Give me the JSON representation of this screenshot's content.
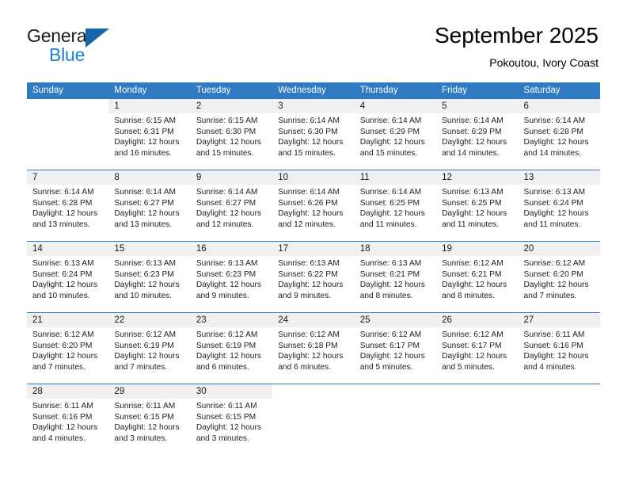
{
  "brand": {
    "name_part1": "General",
    "name_part2": "Blue",
    "accent_color": "#1f7fd0",
    "triangle_color": "#1565a8"
  },
  "header": {
    "title": "September 2025",
    "subtitle": "Pokoutou, Ivory Coast"
  },
  "calendar": {
    "header_bg": "#2f7ac0",
    "daynum_bg": "#f0f0f0",
    "weekdays": [
      "Sunday",
      "Monday",
      "Tuesday",
      "Wednesday",
      "Thursday",
      "Friday",
      "Saturday"
    ],
    "weeks": [
      [
        {
          "day": "",
          "sunrise": "",
          "sunset": "",
          "daylight1": "",
          "daylight2": ""
        },
        {
          "day": "1",
          "sunrise": "Sunrise: 6:15 AM",
          "sunset": "Sunset: 6:31 PM",
          "daylight1": "Daylight: 12 hours",
          "daylight2": "and 16 minutes."
        },
        {
          "day": "2",
          "sunrise": "Sunrise: 6:15 AM",
          "sunset": "Sunset: 6:30 PM",
          "daylight1": "Daylight: 12 hours",
          "daylight2": "and 15 minutes."
        },
        {
          "day": "3",
          "sunrise": "Sunrise: 6:14 AM",
          "sunset": "Sunset: 6:30 PM",
          "daylight1": "Daylight: 12 hours",
          "daylight2": "and 15 minutes."
        },
        {
          "day": "4",
          "sunrise": "Sunrise: 6:14 AM",
          "sunset": "Sunset: 6:29 PM",
          "daylight1": "Daylight: 12 hours",
          "daylight2": "and 15 minutes."
        },
        {
          "day": "5",
          "sunrise": "Sunrise: 6:14 AM",
          "sunset": "Sunset: 6:29 PM",
          "daylight1": "Daylight: 12 hours",
          "daylight2": "and 14 minutes."
        },
        {
          "day": "6",
          "sunrise": "Sunrise: 6:14 AM",
          "sunset": "Sunset: 6:28 PM",
          "daylight1": "Daylight: 12 hours",
          "daylight2": "and 14 minutes."
        }
      ],
      [
        {
          "day": "7",
          "sunrise": "Sunrise: 6:14 AM",
          "sunset": "Sunset: 6:28 PM",
          "daylight1": "Daylight: 12 hours",
          "daylight2": "and 13 minutes."
        },
        {
          "day": "8",
          "sunrise": "Sunrise: 6:14 AM",
          "sunset": "Sunset: 6:27 PM",
          "daylight1": "Daylight: 12 hours",
          "daylight2": "and 13 minutes."
        },
        {
          "day": "9",
          "sunrise": "Sunrise: 6:14 AM",
          "sunset": "Sunset: 6:27 PM",
          "daylight1": "Daylight: 12 hours",
          "daylight2": "and 12 minutes."
        },
        {
          "day": "10",
          "sunrise": "Sunrise: 6:14 AM",
          "sunset": "Sunset: 6:26 PM",
          "daylight1": "Daylight: 12 hours",
          "daylight2": "and 12 minutes."
        },
        {
          "day": "11",
          "sunrise": "Sunrise: 6:14 AM",
          "sunset": "Sunset: 6:25 PM",
          "daylight1": "Daylight: 12 hours",
          "daylight2": "and 11 minutes."
        },
        {
          "day": "12",
          "sunrise": "Sunrise: 6:13 AM",
          "sunset": "Sunset: 6:25 PM",
          "daylight1": "Daylight: 12 hours",
          "daylight2": "and 11 minutes."
        },
        {
          "day": "13",
          "sunrise": "Sunrise: 6:13 AM",
          "sunset": "Sunset: 6:24 PM",
          "daylight1": "Daylight: 12 hours",
          "daylight2": "and 11 minutes."
        }
      ],
      [
        {
          "day": "14",
          "sunrise": "Sunrise: 6:13 AM",
          "sunset": "Sunset: 6:24 PM",
          "daylight1": "Daylight: 12 hours",
          "daylight2": "and 10 minutes."
        },
        {
          "day": "15",
          "sunrise": "Sunrise: 6:13 AM",
          "sunset": "Sunset: 6:23 PM",
          "daylight1": "Daylight: 12 hours",
          "daylight2": "and 10 minutes."
        },
        {
          "day": "16",
          "sunrise": "Sunrise: 6:13 AM",
          "sunset": "Sunset: 6:23 PM",
          "daylight1": "Daylight: 12 hours",
          "daylight2": "and 9 minutes."
        },
        {
          "day": "17",
          "sunrise": "Sunrise: 6:13 AM",
          "sunset": "Sunset: 6:22 PM",
          "daylight1": "Daylight: 12 hours",
          "daylight2": "and 9 minutes."
        },
        {
          "day": "18",
          "sunrise": "Sunrise: 6:13 AM",
          "sunset": "Sunset: 6:21 PM",
          "daylight1": "Daylight: 12 hours",
          "daylight2": "and 8 minutes."
        },
        {
          "day": "19",
          "sunrise": "Sunrise: 6:12 AM",
          "sunset": "Sunset: 6:21 PM",
          "daylight1": "Daylight: 12 hours",
          "daylight2": "and 8 minutes."
        },
        {
          "day": "20",
          "sunrise": "Sunrise: 6:12 AM",
          "sunset": "Sunset: 6:20 PM",
          "daylight1": "Daylight: 12 hours",
          "daylight2": "and 7 minutes."
        }
      ],
      [
        {
          "day": "21",
          "sunrise": "Sunrise: 6:12 AM",
          "sunset": "Sunset: 6:20 PM",
          "daylight1": "Daylight: 12 hours",
          "daylight2": "and 7 minutes."
        },
        {
          "day": "22",
          "sunrise": "Sunrise: 6:12 AM",
          "sunset": "Sunset: 6:19 PM",
          "daylight1": "Daylight: 12 hours",
          "daylight2": "and 7 minutes."
        },
        {
          "day": "23",
          "sunrise": "Sunrise: 6:12 AM",
          "sunset": "Sunset: 6:19 PM",
          "daylight1": "Daylight: 12 hours",
          "daylight2": "and 6 minutes."
        },
        {
          "day": "24",
          "sunrise": "Sunrise: 6:12 AM",
          "sunset": "Sunset: 6:18 PM",
          "daylight1": "Daylight: 12 hours",
          "daylight2": "and 6 minutes."
        },
        {
          "day": "25",
          "sunrise": "Sunrise: 6:12 AM",
          "sunset": "Sunset: 6:17 PM",
          "daylight1": "Daylight: 12 hours",
          "daylight2": "and 5 minutes."
        },
        {
          "day": "26",
          "sunrise": "Sunrise: 6:12 AM",
          "sunset": "Sunset: 6:17 PM",
          "daylight1": "Daylight: 12 hours",
          "daylight2": "and 5 minutes."
        },
        {
          "day": "27",
          "sunrise": "Sunrise: 6:11 AM",
          "sunset": "Sunset: 6:16 PM",
          "daylight1": "Daylight: 12 hours",
          "daylight2": "and 4 minutes."
        }
      ],
      [
        {
          "day": "28",
          "sunrise": "Sunrise: 6:11 AM",
          "sunset": "Sunset: 6:16 PM",
          "daylight1": "Daylight: 12 hours",
          "daylight2": "and 4 minutes."
        },
        {
          "day": "29",
          "sunrise": "Sunrise: 6:11 AM",
          "sunset": "Sunset: 6:15 PM",
          "daylight1": "Daylight: 12 hours",
          "daylight2": "and 3 minutes."
        },
        {
          "day": "30",
          "sunrise": "Sunrise: 6:11 AM",
          "sunset": "Sunset: 6:15 PM",
          "daylight1": "Daylight: 12 hours",
          "daylight2": "and 3 minutes."
        },
        {
          "day": "",
          "sunrise": "",
          "sunset": "",
          "daylight1": "",
          "daylight2": ""
        },
        {
          "day": "",
          "sunrise": "",
          "sunset": "",
          "daylight1": "",
          "daylight2": ""
        },
        {
          "day": "",
          "sunrise": "",
          "sunset": "",
          "daylight1": "",
          "daylight2": ""
        },
        {
          "day": "",
          "sunrise": "",
          "sunset": "",
          "daylight1": "",
          "daylight2": ""
        }
      ]
    ]
  }
}
